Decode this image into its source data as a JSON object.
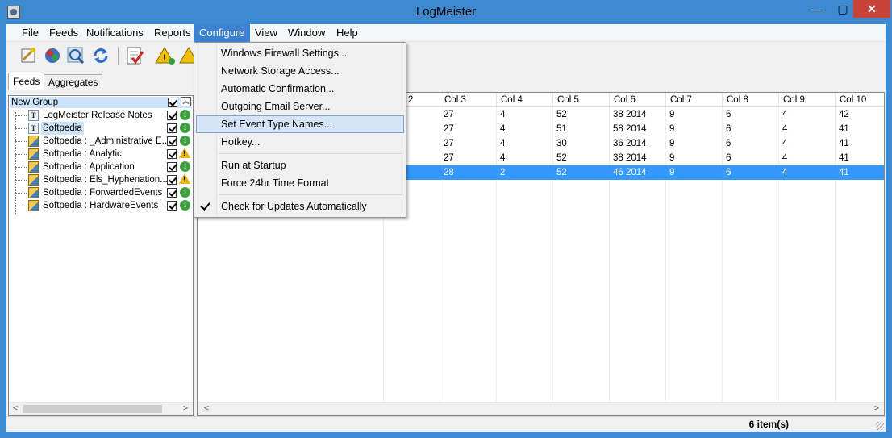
{
  "window": {
    "title": "LogMeister",
    "minimize": "—",
    "maximize": "▢",
    "close": "✕"
  },
  "menubar": [
    "File",
    "Feeds",
    "Notifications",
    "Reports",
    "Configure",
    "View",
    "Window",
    "Help"
  ],
  "active_menu": "Configure",
  "tabs": {
    "feeds": "Feeds",
    "aggregates": "Aggregates"
  },
  "tree": {
    "group_label": "New Group",
    "items": [
      {
        "label": "LogMeister Release Notes",
        "icon": "text-feed-icon",
        "status": "info"
      },
      {
        "label": "Softpedia",
        "icon": "text-feed-icon",
        "status": "info"
      },
      {
        "label": "Softpedia : _Administrative E...",
        "icon": "event-log-icon",
        "status": "info"
      },
      {
        "label": "Softpedia : Analytic",
        "icon": "event-log-icon",
        "status": "warning"
      },
      {
        "label": "Softpedia : Application",
        "icon": "event-log-icon",
        "status": "info"
      },
      {
        "label": "Softpedia : Els_Hyphenation...",
        "icon": "event-log-icon",
        "status": "warning"
      },
      {
        "label": "Softpedia : ForwardedEvents",
        "icon": "event-log-icon",
        "status": "info"
      },
      {
        "label": "Softpedia : HardwareEvents",
        "icon": "event-log-icon",
        "status": "info"
      }
    ]
  },
  "grid": {
    "columns": [
      "2",
      "Col 3",
      "Col 4",
      "Col 5",
      "Col 6",
      "Col 7",
      "Col 8",
      "Col 9",
      "Col 10"
    ],
    "rows": [
      [
        "",
        "27",
        "4",
        "52",
        "38 2014",
        "9",
        "6",
        "4",
        "42"
      ],
      [
        "",
        "27",
        "4",
        "51",
        "58 2014",
        "9",
        "6",
        "4",
        "41"
      ],
      [
        "",
        "27",
        "4",
        "30",
        "36 2014",
        "9",
        "6",
        "4",
        "41"
      ],
      [
        "",
        "27",
        "4",
        "52",
        "38 2014",
        "9",
        "6",
        "4",
        "41"
      ],
      [
        "",
        "28",
        "2",
        "52",
        "46 2014",
        "9",
        "6",
        "4",
        "41"
      ]
    ]
  },
  "status": {
    "count": "6 item(s)"
  },
  "configure_menu": {
    "items": [
      "Windows Firewall Settings...",
      "Network Storage Access...",
      "Automatic Confirmation...",
      "Outgoing Email Server...",
      "Set Event Type Names...",
      "Hotkey...",
      "Run at Startup",
      "Force 24hr Time Format",
      "Check for Updates Automatically"
    ],
    "highlighted": "Set Event Type Names...",
    "checked": "Check for Updates Automatically"
  },
  "colors": {
    "accent": "#3c82d4",
    "selection": "#3399ff",
    "frame": "#3d8ad0"
  }
}
